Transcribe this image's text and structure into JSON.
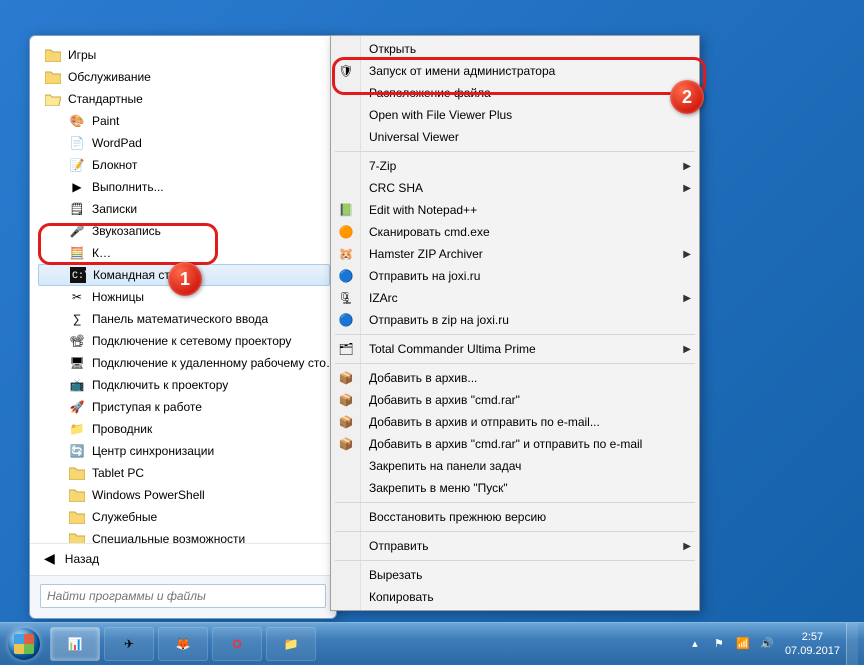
{
  "start_menu": {
    "folders_top": [
      "Игры",
      "Обслуживание",
      "Стандартные"
    ],
    "accessories": [
      {
        "label": "Paint",
        "icon": "paint-icon"
      },
      {
        "label": "WordPad",
        "icon": "wordpad-icon"
      },
      {
        "label": "Блокнот",
        "icon": "notepad-icon"
      },
      {
        "label": "Выполнить...",
        "icon": "run-icon"
      },
      {
        "label": "Записки",
        "icon": "sticky-notes-icon"
      },
      {
        "label": "Звукозапись",
        "icon": "sound-recorder-icon"
      },
      {
        "label": "К…",
        "icon": "calculator-icon"
      },
      {
        "label": "Командная строка",
        "icon": "cmd-icon",
        "selected": true
      },
      {
        "label": "Ножницы",
        "icon": "snipping-tool-icon"
      },
      {
        "label": "Панель математического ввода",
        "icon": "math-input-icon"
      },
      {
        "label": "Подключение к сетевому проектору",
        "icon": "network-projector-icon"
      },
      {
        "label": "Подключение к удаленному рабочему сто…",
        "icon": "rdp-icon"
      },
      {
        "label": "Подключить к проектору",
        "icon": "projector-icon"
      },
      {
        "label": "Приступая к работе",
        "icon": "getting-started-icon"
      },
      {
        "label": "Проводник",
        "icon": "explorer-icon"
      },
      {
        "label": "Центр синхронизации",
        "icon": "sync-center-icon"
      }
    ],
    "accessories_subfolders": [
      "Tablet PC",
      "Windows PowerShell",
      "Служебные",
      "Специальные возможности"
    ],
    "back_label": "Назад",
    "search_placeholder": "Найти программы и файлы"
  },
  "context_menu": {
    "groups": [
      [
        {
          "label": "Открыть",
          "icon": null,
          "submenu": false
        },
        {
          "label": "Запуск от имени администратора",
          "icon": "shield-icon",
          "submenu": false,
          "highlight": true
        },
        {
          "label": "Расположение файла",
          "icon": null,
          "submenu": false
        },
        {
          "label": "Open with File Viewer Plus",
          "icon": null,
          "submenu": false
        },
        {
          "label": "Universal Viewer",
          "icon": null,
          "submenu": false
        }
      ],
      [
        {
          "label": "7-Zip",
          "icon": null,
          "submenu": true
        },
        {
          "label": "CRC SHA",
          "icon": null,
          "submenu": true
        },
        {
          "label": "Edit with Notepad++",
          "icon": "notepadpp-icon",
          "submenu": false
        },
        {
          "label": "Сканировать cmd.exe",
          "icon": "avast-icon",
          "submenu": false
        },
        {
          "label": "Hamster ZIP Archiver",
          "icon": "hamster-icon",
          "submenu": true
        },
        {
          "label": "Отправить на joxi.ru",
          "icon": "joxi-icon",
          "submenu": false
        },
        {
          "label": "IZArc",
          "icon": "izarc-icon",
          "submenu": true
        },
        {
          "label": "Отправить в zip на joxi.ru",
          "icon": "joxi-icon",
          "submenu": false
        }
      ],
      [
        {
          "label": "Total Commander Ultima Prime",
          "icon": "totalcmd-icon",
          "submenu": true
        }
      ],
      [
        {
          "label": "Добавить в архив...",
          "icon": "winrar-icon",
          "submenu": false
        },
        {
          "label": "Добавить в архив \"cmd.rar\"",
          "icon": "winrar-icon",
          "submenu": false
        },
        {
          "label": "Добавить в архив и отправить по e-mail...",
          "icon": "winrar-icon",
          "submenu": false
        },
        {
          "label": "Добавить в архив \"cmd.rar\" и отправить по e-mail",
          "icon": "winrar-icon",
          "submenu": false
        },
        {
          "label": "Закрепить на панели задач",
          "icon": null,
          "submenu": false
        },
        {
          "label": "Закрепить в меню \"Пуск\"",
          "icon": null,
          "submenu": false
        }
      ],
      [
        {
          "label": "Восстановить прежнюю версию",
          "icon": null,
          "submenu": false
        }
      ],
      [
        {
          "label": "Отправить",
          "icon": null,
          "submenu": true
        }
      ],
      [
        {
          "label": "Вырезать",
          "icon": null,
          "submenu": false
        },
        {
          "label": "Копировать",
          "icon": null,
          "submenu": false
        }
      ]
    ]
  },
  "callouts": {
    "badge1": "1",
    "badge2": "2"
  },
  "taskbar": {
    "apps": [
      {
        "icon": "taskmgr-icon"
      },
      {
        "icon": "telegram-icon"
      },
      {
        "icon": "firefox-icon"
      },
      {
        "icon": "opera-icon"
      },
      {
        "icon": "folder-icon"
      }
    ],
    "tray": {
      "flag_icon": "flag-icon",
      "net_icon": "network-icon",
      "vol_icon": "volume-icon",
      "time": "2:57",
      "date": "07.09.2017"
    }
  }
}
